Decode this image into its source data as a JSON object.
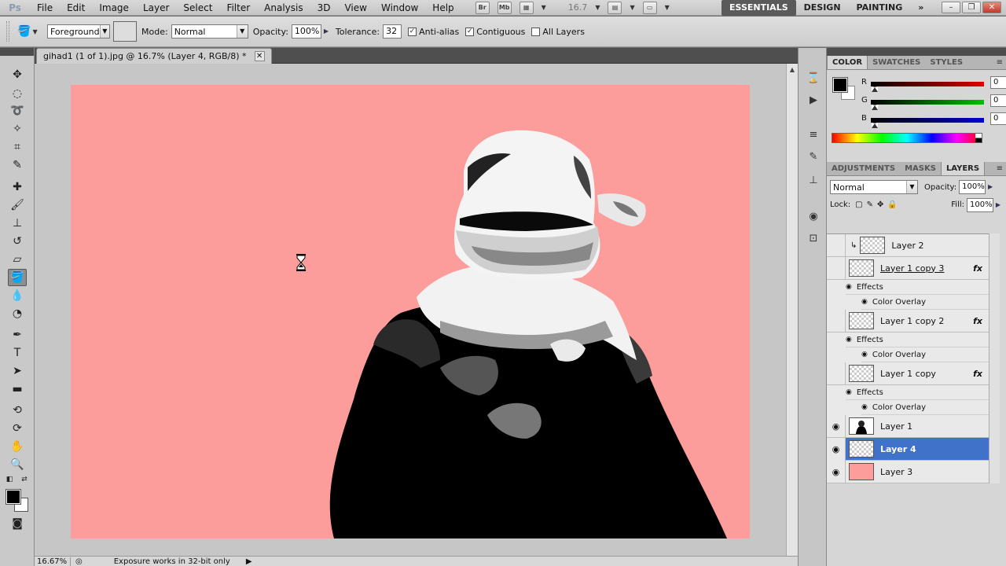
{
  "app": {
    "logo": "Ps"
  },
  "menu": [
    "File",
    "Edit",
    "Image",
    "Layer",
    "Select",
    "Filter",
    "Analysis",
    "3D",
    "View",
    "Window",
    "Help"
  ],
  "appbar": {
    "bridge_label": "Br",
    "minibridge_label": "Mb",
    "zoom": "16.7"
  },
  "workspaces": {
    "essentials": "ESSENTIALS",
    "design": "DESIGN",
    "painting": "PAINTING",
    "more": "»"
  },
  "options": {
    "fill_source": "Foreground",
    "mode_label": "Mode:",
    "mode_value": "Normal",
    "opacity_label": "Opacity:",
    "opacity_value": "100%",
    "tolerance_label": "Tolerance:",
    "tolerance_value": "32",
    "antialias_label": "Anti-alias",
    "antialias_checked": true,
    "contiguous_label": "Contiguous",
    "contiguous_checked": true,
    "alllayers_label": "All Layers",
    "alllayers_checked": false
  },
  "document": {
    "tab_title": "gihad1 (1 of 1).jpg @ 16.7% (Layer 4, RGB/8) *",
    "background_color": "#fc9d9c"
  },
  "status": {
    "zoom": "16.67%",
    "message": "Exposure works in 32-bit only"
  },
  "color_panel": {
    "tabs": [
      "COLOR",
      "SWATCHES",
      "STYLES"
    ],
    "channels": [
      {
        "name": "R",
        "value": "0",
        "color": "#e00000"
      },
      {
        "name": "G",
        "value": "0",
        "color": "#00c000"
      },
      {
        "name": "B",
        "value": "0",
        "color": "#0000d0"
      }
    ]
  },
  "layers_panel": {
    "tabs": [
      "ADJUSTMENTS",
      "MASKS",
      "LAYERS"
    ],
    "blend_mode": "Normal",
    "opacity_label": "Opacity:",
    "opacity_value": "100%",
    "lock_label": "Lock:",
    "fill_label": "Fill:",
    "fill_value": "100%",
    "effects_label": "Effects",
    "color_overlay_label": "Color Overlay",
    "layers": [
      {
        "name": "Layer 2"
      },
      {
        "name": "Layer 1 copy 3"
      },
      {
        "name": "Layer 1 copy 2"
      },
      {
        "name": "Layer 1 copy"
      },
      {
        "name": "Layer 1"
      },
      {
        "name": "Layer 4"
      },
      {
        "name": "Layer 3"
      }
    ]
  }
}
